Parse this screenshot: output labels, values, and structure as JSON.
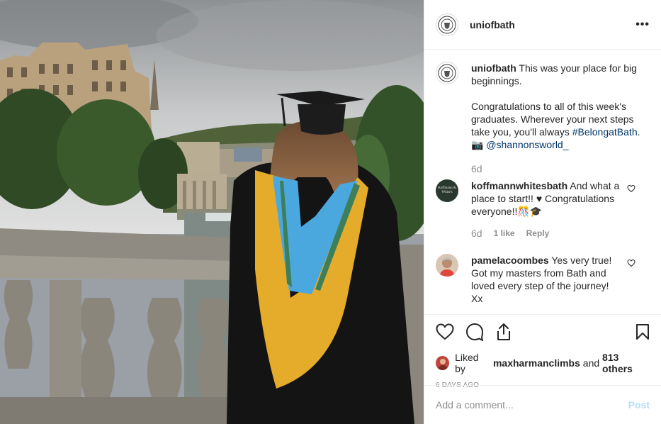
{
  "post": {
    "photo_alt": "",
    "author": "uniofbath",
    "caption_author": "uniofbath",
    "caption_lines": [
      "This was your place for big",
      "beginnings."
    ],
    "caption2_lines": [
      "Congratulations to all of this week's",
      "graduates. Wherever your next steps",
      "take you, you'll always "
    ],
    "hashtag": "#BelongatBath",
    "hashtag_tail": ".",
    "camera_emoji": "📷",
    "mention": "@shannonsworld_",
    "caption_age": "6d",
    "likes_user": "maxharmanclimbs",
    "likes_prefix": "Liked by ",
    "likes_and": " and ",
    "likes_count_text": "813 others",
    "timestamp": "6 DAYS AGO"
  },
  "comments": [
    {
      "user": "koffmannwhitesbath",
      "lines": [
        "And what a",
        "place to start!! ♥ Congratulations",
        "everyone!!🎊🎓"
      ],
      "age": "6d",
      "likes": "1 like",
      "reply": "Reply",
      "avatar_text": "Koffmann & White's"
    },
    {
      "user": "pamelacoombes",
      "lines": [
        "Yes very true!",
        "Got my masters from Bath and",
        "loved every step of the journey!",
        "Xx"
      ]
    }
  ],
  "comment_box": {
    "placeholder": "Add a comment...",
    "post_label": "Post"
  },
  "icons": [
    "more-icon",
    "heart-icon",
    "comment-icon",
    "share-icon",
    "bookmark-icon",
    "small-heart-icon"
  ],
  "colors": {
    "link": "#003569",
    "post_disabled": "#b2dffc",
    "muted": "#8e8e8e",
    "border": "#efefef"
  }
}
